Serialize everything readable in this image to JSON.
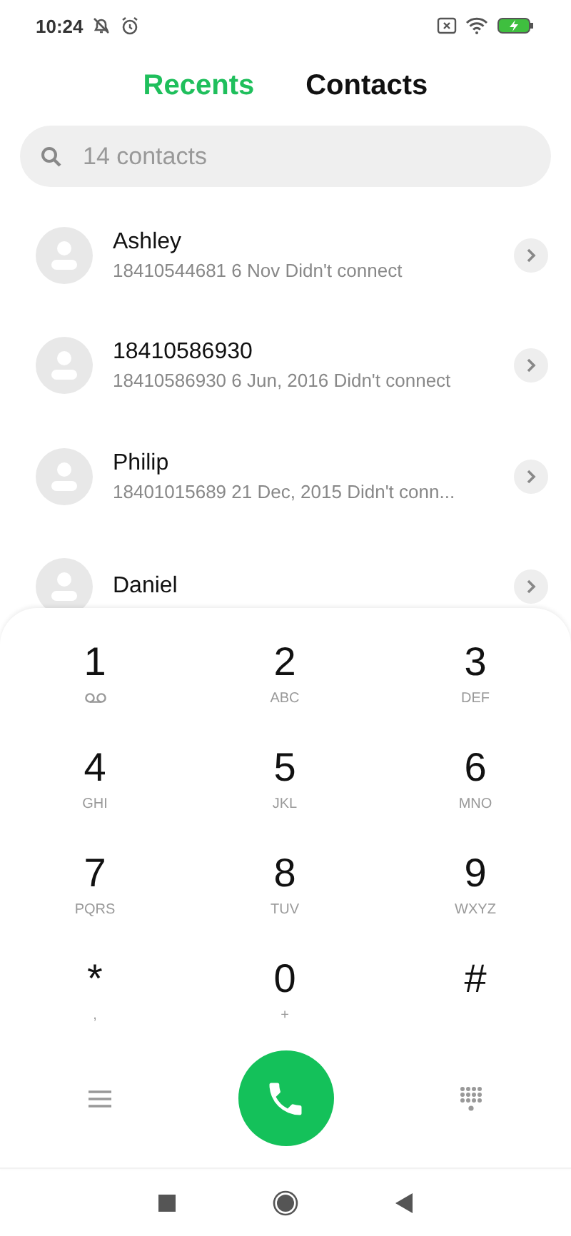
{
  "status_bar": {
    "time": "10:24"
  },
  "tabs": [
    {
      "label": "Recents",
      "selected": true
    },
    {
      "label": "Contacts",
      "selected": false
    }
  ],
  "search": {
    "placeholder": "14 contacts"
  },
  "calls": [
    {
      "name": "Ashley",
      "detail": "18410544681  6 Nov Didn't connect"
    },
    {
      "name": "18410586930",
      "detail": "18410586930  6 Jun, 2016 Didn't connect"
    },
    {
      "name": "Philip",
      "detail": "18401015689  21 Dec, 2015 Didn't conn..."
    },
    {
      "name": "Daniel"
    }
  ],
  "keypad": [
    {
      "digit": "1",
      "kind": "voicemail"
    },
    {
      "digit": "2",
      "letters": "ABC"
    },
    {
      "digit": "3",
      "letters": "DEF"
    },
    {
      "digit": "4",
      "letters": "GHI"
    },
    {
      "digit": "5",
      "letters": "JKL"
    },
    {
      "digit": "6",
      "letters": "MNO"
    },
    {
      "digit": "7",
      "letters": "PQRS"
    },
    {
      "digit": "8",
      "letters": "TUV"
    },
    {
      "digit": "9",
      "letters": "WXYZ"
    },
    {
      "digit": "*",
      "letters": ","
    },
    {
      "digit": "0",
      "letters": "+"
    },
    {
      "digit": "#"
    }
  ]
}
